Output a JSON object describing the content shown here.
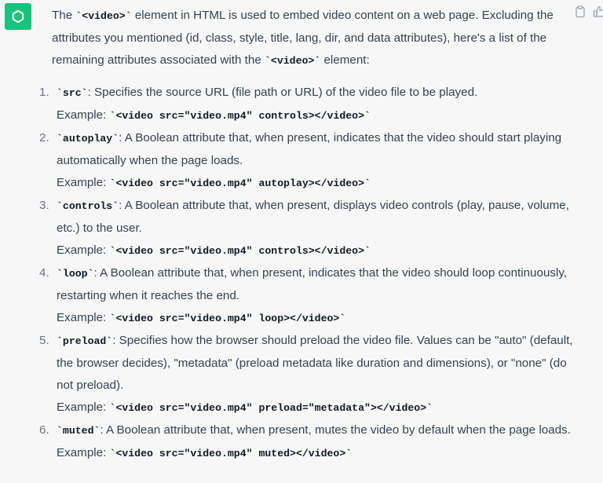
{
  "colors": {
    "avatar_bg": "#19c37d",
    "text": "#374151",
    "code": "#111827"
  },
  "icons": {
    "avatar": "openai-logo-icon",
    "copy": "clipboard-icon",
    "thumbs": "thumbs-up-icon"
  },
  "intro": {
    "t1": "The ",
    "c1": "`<video>`",
    "t2": " element in HTML is used to embed video content on a web page. Excluding the attributes you mentioned (id, class, style, title, lang, dir, and data attributes), here's a list of the remaining attributes associated with the ",
    "c2": "`<video>`",
    "t3": " element:"
  },
  "items": [
    {
      "num": "1.",
      "code": "`src`",
      "desc": ": Specifies the source URL (file path or URL) of the video file to be played.",
      "example_label": "Example: ",
      "example_code": "`<video src=\"video.mp4\" controls></video>`"
    },
    {
      "num": "2.",
      "code": "`autoplay`",
      "desc": ": A Boolean attribute that, when present, indicates that the video should start playing automatically when the page loads.",
      "example_label": "Example: ",
      "example_code": "`<video src=\"video.mp4\" autoplay></video>`"
    },
    {
      "num": "3.",
      "code": "`controls`",
      "desc": ": A Boolean attribute that, when present, displays video controls (play, pause, volume, etc.) to the user.",
      "example_label": "Example: ",
      "example_code": "`<video src=\"video.mp4\" controls></video>`"
    },
    {
      "num": "4.",
      "code": "`loop`",
      "desc": ": A Boolean attribute that, when present, indicates that the video should loop continuously, restarting when it reaches the end.",
      "example_label": "Example: ",
      "example_code": "`<video src=\"video.mp4\" loop></video>`"
    },
    {
      "num": "5.",
      "code": "`preload`",
      "desc": ": Specifies how the browser should preload the video file. Values can be \"auto\" (default, the browser decides), \"metadata\" (preload metadata like duration and dimensions), or \"none\" (do not preload).",
      "example_label": "Example: ",
      "example_code": "`<video src=\"video.mp4\" preload=\"metadata\"></video>`"
    },
    {
      "num": "6.",
      "code": "`muted`",
      "desc": ": A Boolean attribute that, when present, mutes the video by default when the page loads.",
      "example_label": "Example: ",
      "example_code": "`<video src=\"video.mp4\" muted></video>`"
    }
  ]
}
